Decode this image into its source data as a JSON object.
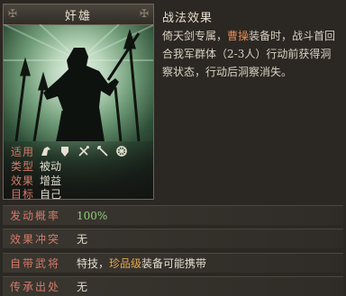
{
  "skill": {
    "name": "奸雄",
    "title": "战法效果",
    "description_parts": [
      "倚天剑专属，",
      "曹操",
      "装备时，战斗首回合我军群体（2-3人）行动前获得洞察状态，行动后洞察消失。"
    ]
  },
  "card_stats": {
    "applicable_label": "适用",
    "type_label": "类型",
    "type_value": "被动",
    "effect_label": "效果",
    "effect_value": "增益",
    "target_label": "目标",
    "target_value": "自己",
    "troop_icons": [
      "cavalry-icon",
      "shield-icon",
      "archer-icon",
      "spear-icon",
      "siege-icon"
    ]
  },
  "info": {
    "rows": [
      {
        "label": "发动概率",
        "value": "100%"
      },
      {
        "label": "效果冲突",
        "value": "无"
      },
      {
        "label": "自带武将",
        "value_prefix": "特技，",
        "value_highlight": "珍品级",
        "value_suffix": "装备可能携带"
      },
      {
        "label": "传承出处",
        "value": "无"
      }
    ]
  },
  "colors": {
    "label": "#d47b6a",
    "highlight_orange": "#e08a58",
    "highlight_gold": "#e3a94f",
    "value_green": "#8fcf7e"
  }
}
